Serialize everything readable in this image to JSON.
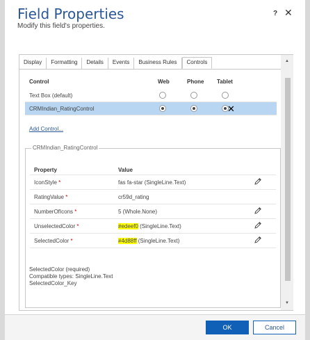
{
  "dialog": {
    "title": "Field Properties",
    "subtitle": "Modify this field's properties.",
    "help_label": "?",
    "close_label": "✕"
  },
  "tabs": [
    {
      "label": "Display"
    },
    {
      "label": "Formatting"
    },
    {
      "label": "Details"
    },
    {
      "label": "Events"
    },
    {
      "label": "Business Rules"
    },
    {
      "label": "Controls",
      "active": true
    }
  ],
  "controls": {
    "headers": {
      "control": "Control",
      "web": "Web",
      "phone": "Phone",
      "tablet": "Tablet"
    },
    "rows": [
      {
        "name": "Text Box (default)",
        "web": false,
        "phone": false,
        "tablet": false,
        "selected": false
      },
      {
        "name": "CRMIndian_RatingControl",
        "web": true,
        "phone": true,
        "tablet": true,
        "selected": true
      }
    ],
    "remove_label": "✕",
    "add_control_label": "Add Control..."
  },
  "properties": {
    "legend": "CRMIndian_RatingControl",
    "headers": {
      "property": "Property",
      "value": "Value"
    },
    "rows": [
      {
        "name": "IconStyle",
        "required_mark": "*",
        "value": "fas fa-star (SingleLine.Text)"
      },
      {
        "name": "RatingValue",
        "required_mark": "*",
        "value": "cr59d_rating"
      },
      {
        "name": "NumberOfIcons",
        "required_mark": "*",
        "value": "5 (Whole.None)"
      },
      {
        "name": "UnselectedColor",
        "required_mark": "*",
        "value_highlight": "#edeef0",
        "value_rest": " (SingleLine.Text)"
      },
      {
        "name": "SelectedColor",
        "required_mark": "*",
        "value_highlight": "#4d88ff",
        "value_rest": " (SingleLine.Text)"
      }
    ],
    "description": {
      "line1": "SelectedColor (required)",
      "line2": "Compatible types: SingleLine.Text",
      "line3": "SelectedColor_Key"
    }
  },
  "footer": {
    "ok_label": "OK",
    "cancel_label": "Cancel"
  },
  "colors": {
    "title": "#2b5797",
    "selected_row": "#b8d6f2",
    "highlight": "#ffff00",
    "primary_button": "#1160b7"
  }
}
